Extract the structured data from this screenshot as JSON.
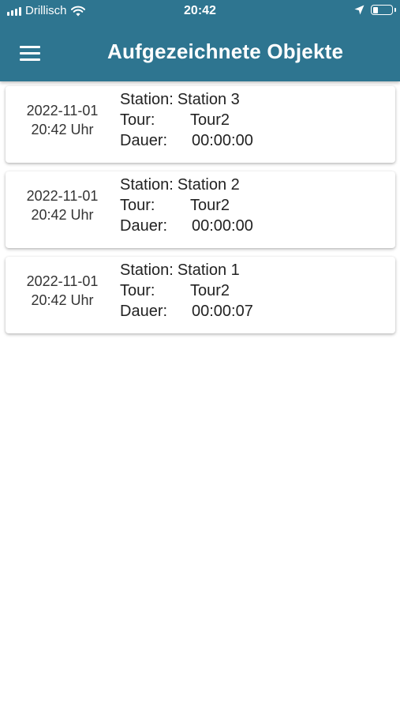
{
  "status_bar": {
    "carrier": "Drillisch",
    "time": "20:42",
    "icons": [
      "signal-icon",
      "wifi-icon",
      "location-arrow-icon",
      "battery-icon"
    ]
  },
  "app_bar": {
    "menu_icon": "hamburger-menu-icon",
    "title": "Aufgezeichnete Objekte"
  },
  "colors": {
    "primary": "#2e7590",
    "background": "#ffffff",
    "text": "#222222"
  },
  "records": [
    {
      "date": "2022-11-01",
      "time": "20:42 Uhr",
      "station_label": "Station:",
      "station": "Station 3",
      "tour_label": "Tour:",
      "tour": "Tour2",
      "duration_label": "Dauer:",
      "duration": "00:00:00"
    },
    {
      "date": "2022-11-01",
      "time": "20:42 Uhr",
      "station_label": "Station:",
      "station": "Station 2",
      "tour_label": "Tour:",
      "tour": "Tour2",
      "duration_label": "Dauer:",
      "duration": "00:00:00"
    },
    {
      "date": "2022-11-01",
      "time": "20:42 Uhr",
      "station_label": "Station:",
      "station": "Station 1",
      "tour_label": "Tour:",
      "tour": "Tour2",
      "duration_label": "Dauer:",
      "duration": "00:00:07"
    }
  ]
}
